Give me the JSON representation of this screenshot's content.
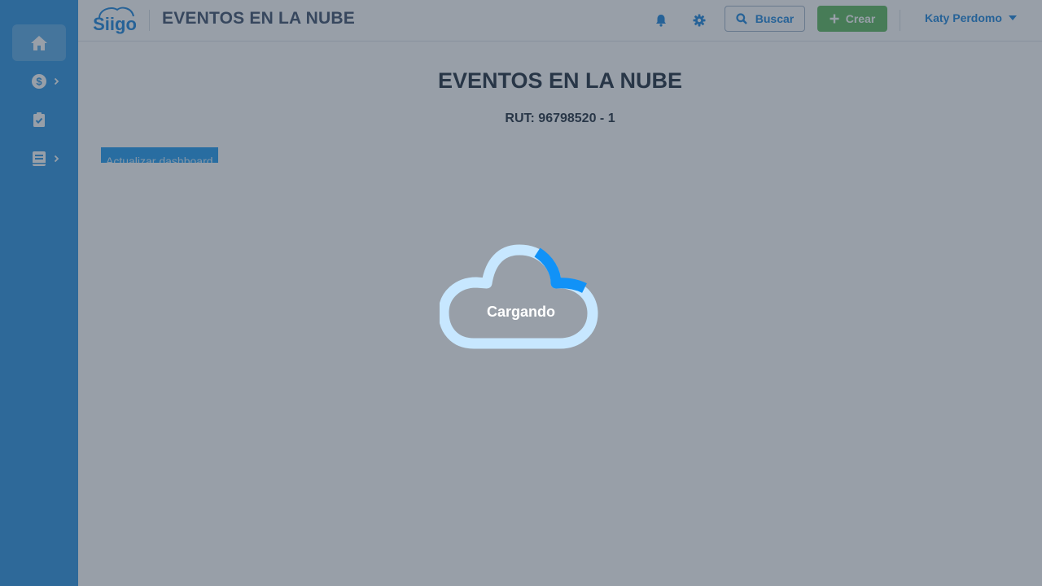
{
  "header": {
    "logo_text": "Siigo",
    "title": "EVENTOS EN LA NUBE",
    "search_label": "Buscar",
    "create_label": "Crear",
    "user_name": "Katy Perdomo",
    "icons": [
      "bell-icon",
      "gear-icon",
      "search-icon",
      "plus-icon",
      "caret-down-icon"
    ]
  },
  "sidebar": {
    "items": [
      {
        "icon": "home-icon",
        "active": true,
        "has_submenu": false
      },
      {
        "icon": "dollar-icon",
        "active": false,
        "has_submenu": true
      },
      {
        "icon": "clipboard-check-icon",
        "active": false,
        "has_submenu": false
      },
      {
        "icon": "book-icon",
        "active": false,
        "has_submenu": true
      }
    ]
  },
  "main": {
    "title": "EVENTOS EN LA NUBE",
    "rut": "RUT: 96798520 - 1",
    "update_button": "Actualizar dashboard"
  },
  "loader": {
    "text": "Cargando"
  },
  "colors": {
    "sidebar": "#2a93e0",
    "primary": "#1a85dd",
    "create": "#5cb85c",
    "overlay": "rgba(50,64,82,0.5)",
    "loader_track": "#c7e7ff",
    "loader_arc": "#1192f7"
  }
}
